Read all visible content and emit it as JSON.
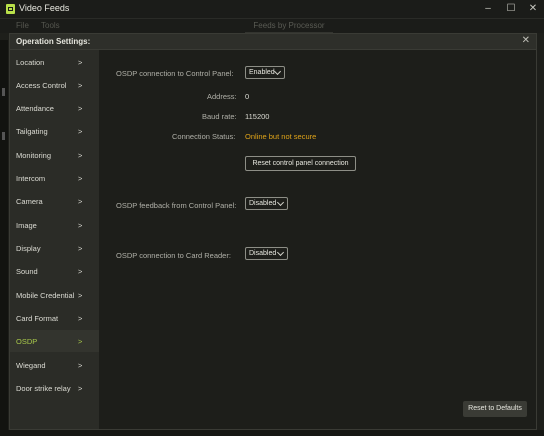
{
  "window": {
    "title": "Video Feeds",
    "controls": {
      "minimize": "–",
      "maximize": "☐",
      "close": "✕"
    }
  },
  "menu": {
    "file": "File",
    "tools": "Tools",
    "feeds_tab": "Feeds by Processor"
  },
  "dialog": {
    "title": "Operation Settings:",
    "close": "✕"
  },
  "sidebar": {
    "chevron": ">",
    "items": [
      {
        "label": "Location"
      },
      {
        "label": "Access Control"
      },
      {
        "label": "Attendance"
      },
      {
        "label": "Tailgating"
      },
      {
        "label": "Monitoring"
      },
      {
        "label": "Intercom"
      },
      {
        "label": "Camera"
      },
      {
        "label": "Image"
      },
      {
        "label": "Display"
      },
      {
        "label": "Sound"
      },
      {
        "label": "Mobile Credential"
      },
      {
        "label": "Card Format"
      },
      {
        "label": "OSDP",
        "active": true
      },
      {
        "label": "Wiegand"
      },
      {
        "label": "Door strike relay"
      }
    ]
  },
  "osdp": {
    "control_panel_label": "OSDP connection to Control Panel:",
    "control_panel_value": "Enabled",
    "address_label": "Address:",
    "address_value": "0",
    "baud_label": "Baud rate:",
    "baud_value": "115200",
    "status_label": "Connection Status:",
    "status_value": "Online but not secure",
    "reset_button": "Reset control panel connection",
    "feedback_label": "OSDP feedback from Control Panel:",
    "feedback_value": "Disabled",
    "card_reader_label": "OSDP connection to Card Reader:",
    "card_reader_value": "Disabled"
  },
  "footer": {
    "reset_defaults": "Reset to Defaults"
  },
  "colors": {
    "accent_green": "#a9c94a",
    "warning_orange": "#e0a419",
    "background": "#1e1f1b"
  }
}
